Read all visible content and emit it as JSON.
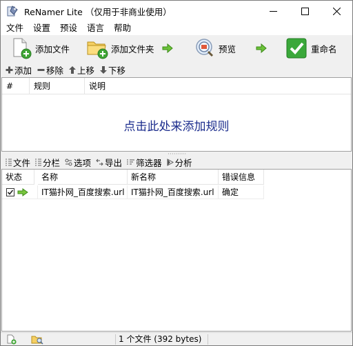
{
  "window": {
    "title": "ReNamer Lite （仅用于非商业使用）",
    "minimize_icon": "minimize-icon",
    "maximize_icon": "maximize-icon",
    "close_icon": "close-icon"
  },
  "menu": [
    "文件",
    "设置",
    "预设",
    "语言",
    "帮助"
  ],
  "toolbar": {
    "add_files": "添加文件",
    "add_folders": "添加文件夹",
    "preview": "预览",
    "rename": "重命名"
  },
  "rules_toolbar": {
    "add": "添加",
    "remove": "移除",
    "up": "上移",
    "down": "下移"
  },
  "rules_table": {
    "columns": [
      "#",
      "规则",
      "说明"
    ],
    "empty_hint": "点击此处来添加规则"
  },
  "files_toolbar": {
    "files": "文件",
    "columns": "分栏",
    "options": "选项",
    "export": "导出",
    "filter": "筛选器",
    "analyze": "分析"
  },
  "files_table": {
    "columns": [
      "状态",
      "名称",
      "新名称",
      "错误信息"
    ],
    "rows": [
      {
        "checked": true,
        "name": "IT猫扑网_百度搜索.url",
        "new_name": "IT猫扑网_百度搜索.url",
        "error": "确定"
      }
    ]
  },
  "statusbar": {
    "summary": "1 个文件 (392 bytes)"
  },
  "colors": {
    "accent_hint": "#1a2b8c",
    "arrow_green": "#3aa51e",
    "rename_green": "#2e9a2e"
  }
}
